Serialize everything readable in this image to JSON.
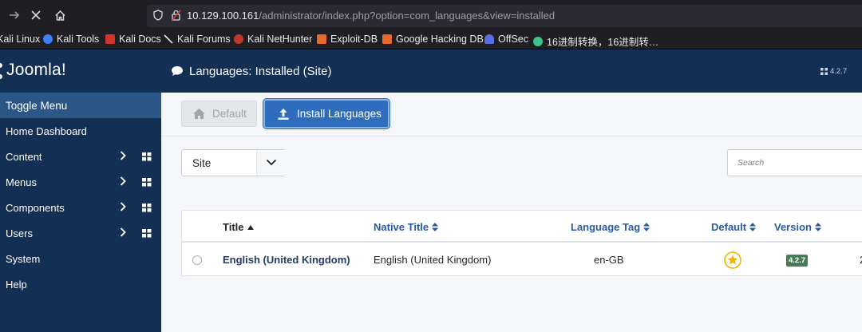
{
  "browser": {
    "url_host": "10.129.100.161",
    "url_rest": "/administrator/index.php?option=com_languages&view=installed",
    "bookmarks": [
      {
        "label": "Kali Linux",
        "icon": "kali-dragon-icon"
      },
      {
        "label": "Kali Tools",
        "icon": "kali-tools-icon"
      },
      {
        "label": "Kali Docs",
        "icon": "kali-docs-icon"
      },
      {
        "label": "Kali Forums",
        "icon": "kali-forums-icon"
      },
      {
        "label": "Kali NetHunter",
        "icon": "nethunter-icon"
      },
      {
        "label": "Exploit-DB",
        "icon": "exploit-db-icon"
      },
      {
        "label": "Google Hacking DB",
        "icon": "ghdb-icon"
      },
      {
        "label": "OffSec",
        "icon": "offsec-icon"
      },
      {
        "label": "16进制转换，16进制转…",
        "icon": "hex-convert-icon"
      }
    ]
  },
  "sidebar": {
    "logo_text": "Joomla!",
    "toggle_label": "Toggle Menu",
    "items": [
      {
        "label": "Home Dashboard",
        "submenu": false
      },
      {
        "label": "Content",
        "submenu": true
      },
      {
        "label": "Menus",
        "submenu": true
      },
      {
        "label": "Components",
        "submenu": true
      },
      {
        "label": "Users",
        "submenu": true
      },
      {
        "label": "System",
        "submenu": false
      },
      {
        "label": "Help",
        "submenu": false
      }
    ]
  },
  "header": {
    "title": "Languages: Installed (Site)",
    "version": "4.2.7"
  },
  "toolbar": {
    "default_label": "Default",
    "install_label": "Install Languages"
  },
  "filters": {
    "client_value": "Site",
    "search_placeholder": "Search"
  },
  "table": {
    "columns": [
      "Title",
      "Native Title",
      "Language Tag",
      "Default",
      "Version"
    ],
    "rows": [
      {
        "title": "English (United Kingdom)",
        "native_title": "English (United Kingdom)",
        "language_tag": "en-GB",
        "is_default": true,
        "version": "4.2.7"
      }
    ]
  },
  "colors": {
    "sidebar_bg": "#132f53",
    "toggle_bg": "#2a5787",
    "primary_button": "#2e6dbc",
    "version_badge": "#457d54",
    "default_star": "#f0b400"
  }
}
